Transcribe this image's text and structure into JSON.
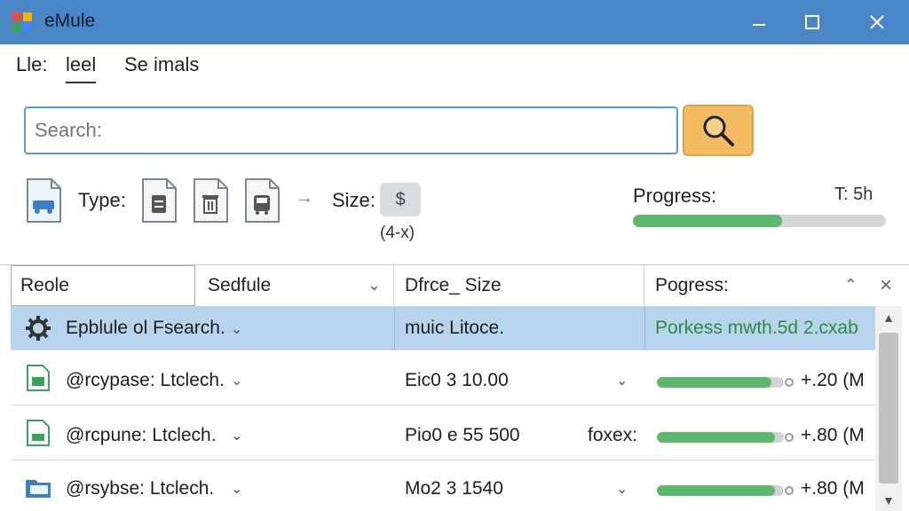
{
  "window": {
    "title": "eMule"
  },
  "menu": {
    "items": [
      "Lle:",
      "leel",
      "Se imals"
    ],
    "active_index": 1
  },
  "search": {
    "placeholder": "Search:",
    "value": ""
  },
  "filters": {
    "type_label": "Type:",
    "type_icons": [
      "car-document-icon",
      "document-icon",
      "trash-document-icon",
      "bus-document-icon"
    ],
    "size_label": "Size:",
    "size_button": "$",
    "size_sub": "(4-x)"
  },
  "progress": {
    "title": "Progress:",
    "extra": "T: 5h",
    "fraction": 0.59,
    "color": "#5cb86a"
  },
  "table": {
    "columns": [
      {
        "label": "Reole",
        "has_chevron": false
      },
      {
        "label": "Sedfule",
        "has_chevron": true,
        "chevron": "chevron-down"
      },
      {
        "label": "Dfrce_ Size",
        "has_chevron": false
      },
      {
        "label": "Pogress:",
        "has_chevron": true,
        "chevron": "chevron-up"
      }
    ],
    "close_label": "×",
    "rows": [
      {
        "icon": "gear-icon",
        "name": "Epblule ol Fsearch.",
        "size": "muic Litoce.",
        "extra": "",
        "progress_text": "Porkess mwth.5d  2.cxab",
        "progress_fraction": null,
        "selected": true
      },
      {
        "icon": "file-icon",
        "name": "@rcypase: Ltclech.",
        "size": "Eic0 3 10.00",
        "extra": "",
        "progress_text": "+.20 (M",
        "progress_fraction": 0.9,
        "selected": false
      },
      {
        "icon": "file-icon",
        "name": "@rcpune: Ltclech.",
        "size": "Pio0 e 55 500",
        "extra": "foxex:",
        "progress_text": "+.80 (M",
        "progress_fraction": 0.93,
        "selected": false
      },
      {
        "icon": "folder-icon",
        "name": "@rsybse: Ltclech.",
        "size": "Mo2 3 1540",
        "extra": "",
        "progress_text": "+.80 (M",
        "progress_fraction": 0.93,
        "selected": false
      }
    ]
  },
  "colors": {
    "titlebar": "#4a86c5",
    "accent": "#5b9bd5",
    "selection": "#b8d3ec",
    "progress": "#5cb86a",
    "search_button": "#f3bc63"
  }
}
